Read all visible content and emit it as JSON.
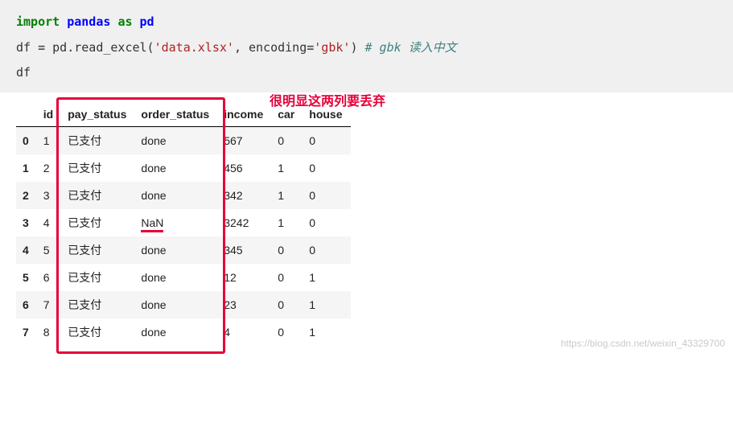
{
  "code": {
    "line1_import": "import",
    "line1_mod": "pandas",
    "line1_as": "as",
    "line1_alias": "pd",
    "line2_lhs": "df ",
    "line2_eq": "=",
    "line2_call": " pd.read_excel(",
    "line2_arg1": "'data.xlsx'",
    "line2_sep": ", encoding",
    "line2_eq2": "=",
    "line2_arg2": "'gbk'",
    "line2_close": ") ",
    "line2_comment": "# gbk 读入中文",
    "line3": "df"
  },
  "annotation": "很明显这两列要丢弃",
  "table": {
    "index_name": "",
    "columns": [
      "id",
      "pay_status",
      "order_status",
      "income",
      "car",
      "house"
    ],
    "rows": [
      {
        "idx": "0",
        "id": "1",
        "pay_status": "已支付",
        "order_status": "done",
        "income": "567",
        "car": "0",
        "house": "0"
      },
      {
        "idx": "1",
        "id": "2",
        "pay_status": "已支付",
        "order_status": "done",
        "income": "456",
        "car": "1",
        "house": "0"
      },
      {
        "idx": "2",
        "id": "3",
        "pay_status": "已支付",
        "order_status": "done",
        "income": "342",
        "car": "1",
        "house": "0"
      },
      {
        "idx": "3",
        "id": "4",
        "pay_status": "已支付",
        "order_status": "NaN",
        "income": "3242",
        "car": "1",
        "house": "0"
      },
      {
        "idx": "4",
        "id": "5",
        "pay_status": "已支付",
        "order_status": "done",
        "income": "345",
        "car": "0",
        "house": "0"
      },
      {
        "idx": "5",
        "id": "6",
        "pay_status": "已支付",
        "order_status": "done",
        "income": "12",
        "car": "0",
        "house": "1"
      },
      {
        "idx": "6",
        "id": "7",
        "pay_status": "已支付",
        "order_status": "done",
        "income": "23",
        "car": "0",
        "house": "1"
      },
      {
        "idx": "7",
        "id": "8",
        "pay_status": "已支付",
        "order_status": "done",
        "income": "4",
        "car": "0",
        "house": "1"
      }
    ]
  },
  "watermark": "https://blog.csdn.net/weixin_43329700"
}
